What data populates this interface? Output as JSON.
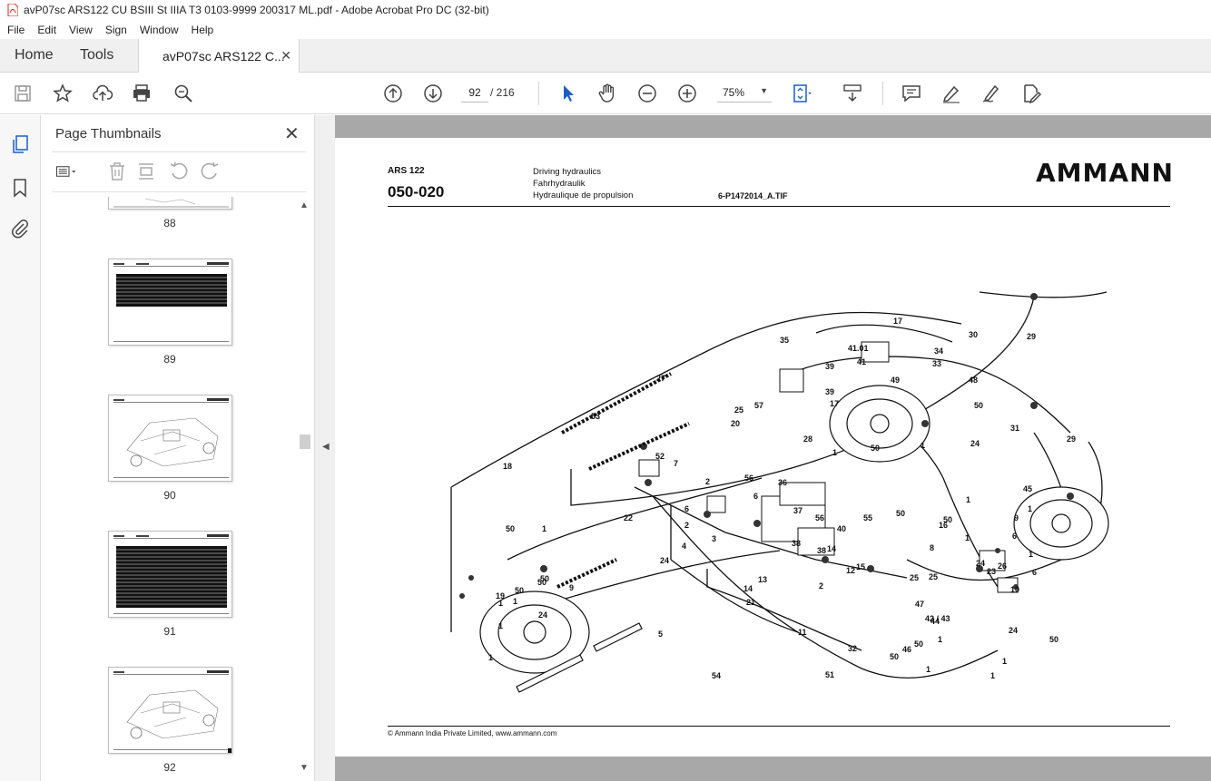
{
  "window": {
    "title": "avP07sc ARS122 CU BSIII St IIIA T3 0103-9999 200317 ML.pdf - Adobe Acrobat Pro DC (32-bit)"
  },
  "menu": [
    "File",
    "Edit",
    "View",
    "Sign",
    "Window",
    "Help"
  ],
  "tabs": {
    "home": "Home",
    "tools": "Tools",
    "document": "avP07sc ARS122 C..."
  },
  "toolbar": {
    "page_current": "92",
    "page_total": "/ 216",
    "zoom": "75%"
  },
  "panel": {
    "title": "Page Thumbnails",
    "thumbnails": [
      {
        "label": "88"
      },
      {
        "label": "89"
      },
      {
        "label": "90"
      },
      {
        "label": "91"
      },
      {
        "label": "92"
      }
    ]
  },
  "document": {
    "model": "ARS 122",
    "code": "050-020",
    "description": [
      "Driving hydraulics",
      "Fahrhydraulik",
      "Hydraulique de propulsion"
    ],
    "file_ref": "6-P1472014_A.TIF",
    "brand": "AMMANN",
    "footer": "© Ammann India Private Limited, www.ammann.com",
    "callouts": [
      "17",
      "29",
      "30",
      "35",
      "41.01",
      "34",
      "39",
      "41",
      "33",
      "49",
      "48",
      "27",
      "39",
      "17",
      "50",
      "25",
      "57",
      "53",
      "20",
      "28",
      "1",
      "31",
      "24",
      "1",
      "29",
      "50",
      "52",
      "18",
      "7",
      "56",
      "2",
      "36",
      "6",
      "6",
      "2",
      "56",
      "37",
      "55",
      "40",
      "14",
      "38",
      "3",
      "22",
      "8",
      "16",
      "4",
      "24",
      "25",
      "2",
      "38",
      "13",
      "15",
      "14",
      "12",
      "21",
      "11",
      "32",
      "5",
      "51",
      "54",
      "50",
      "50",
      "1",
      "50",
      "1",
      "1",
      "1",
      "24",
      "19",
      "9",
      "50",
      "1",
      "50",
      "1",
      "45",
      "9",
      "1",
      "50",
      "1",
      "6",
      "1",
      "24",
      "26",
      "6",
      "23",
      "10",
      "25",
      "42 / 43",
      "46",
      "47",
      "44",
      "1",
      "50",
      "50",
      "1",
      "24",
      "50",
      "1",
      "1"
    ]
  }
}
